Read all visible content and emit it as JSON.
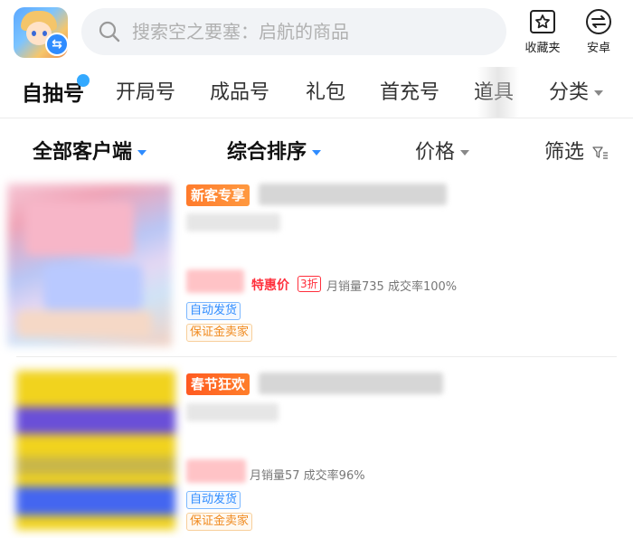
{
  "search": {
    "placeholder": "搜索空之要塞：启航的商品"
  },
  "header": {
    "favorites_label": "收藏夹",
    "android_label": "安卓"
  },
  "categories": [
    {
      "label": "自抽号",
      "active": true,
      "has_dot": true
    },
    {
      "label": "开局号"
    },
    {
      "label": "成品号"
    },
    {
      "label": "礼包"
    },
    {
      "label": "首充号"
    },
    {
      "label": "道具"
    },
    {
      "label": "分类",
      "has_caret": true
    }
  ],
  "filters": {
    "client": "全部客户端",
    "sort": "综合排序",
    "price": "价格",
    "screen": "筛选"
  },
  "products": [
    {
      "tag": "新客专享",
      "special_price_label": "特惠价",
      "discount": "3折",
      "sales": "月销量735 成交率100%",
      "badges": [
        "自动发货",
        "保证金卖家"
      ]
    },
    {
      "tag": "春节狂欢",
      "sales": "月销量57 成交率96%",
      "badges": [
        "自动发货",
        "保证金卖家"
      ]
    }
  ],
  "colors": {
    "accent_blue": "#2f8cff",
    "price_red": "#ff2f3c",
    "tag_orange": "#ff7b2c",
    "seller_orange": "#f08a1f"
  }
}
